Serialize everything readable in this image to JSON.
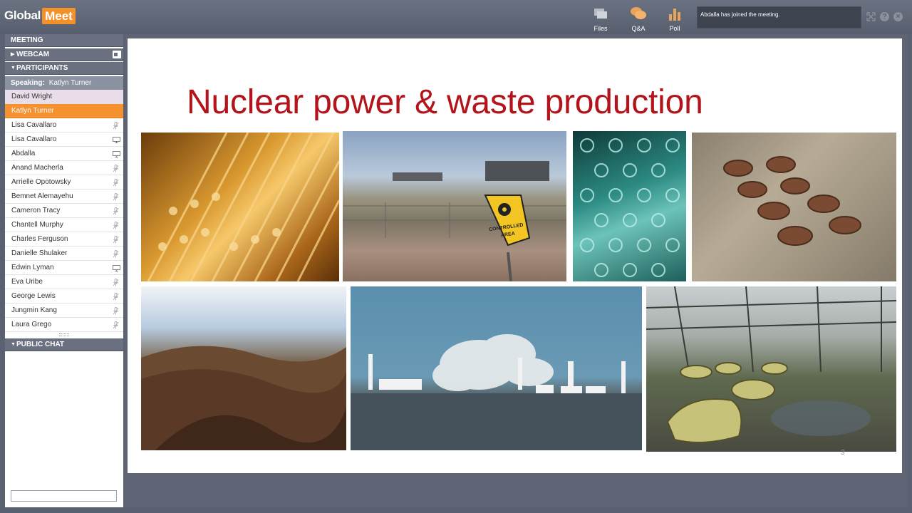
{
  "app": {
    "logo_part1": "Global",
    "logo_part2": "Meet"
  },
  "toolbar": {
    "files_label": "Files",
    "qa_label": "Q&A",
    "poll_label": "Poll"
  },
  "notification": "Abdalla has joined the meeting.",
  "sidebar": {
    "meeting_label": "MEETING",
    "webcam_label": "WEBCAM",
    "participants_label": "PARTICIPANTS",
    "public_chat_label": "PUBLIC CHAT",
    "speaking_label": "Speaking:",
    "speaking_name": "Katlyn Turner",
    "participants": [
      {
        "name": "David Wright",
        "status": "host",
        "icon": "none"
      },
      {
        "name": "Katlyn Turner",
        "status": "active",
        "icon": "none"
      },
      {
        "name": "Lisa Cavallaro",
        "status": "normal",
        "icon": "mic-off-icon"
      },
      {
        "name": "Lisa Cavallaro",
        "status": "normal",
        "icon": "monitor-icon"
      },
      {
        "name": "Abdalla",
        "status": "normal",
        "icon": "monitor-icon"
      },
      {
        "name": "Anand Macherla",
        "status": "normal",
        "icon": "mic-off-icon"
      },
      {
        "name": "Arrielle Opotowsky",
        "status": "normal",
        "icon": "mic-off-icon"
      },
      {
        "name": "Bemnet Alemayehu",
        "status": "normal",
        "icon": "mic-off-icon"
      },
      {
        "name": "Cameron Tracy",
        "status": "normal",
        "icon": "mic-off-icon"
      },
      {
        "name": "Chantell Murphy",
        "status": "normal",
        "icon": "mic-off-icon"
      },
      {
        "name": "Charles Ferguson",
        "status": "normal",
        "icon": "mic-off-icon"
      },
      {
        "name": "Danielle Shulaker",
        "status": "normal",
        "icon": "mic-off-icon"
      },
      {
        "name": "Edwin Lyman",
        "status": "normal",
        "icon": "monitor-icon"
      },
      {
        "name": "Eva Uribe",
        "status": "normal",
        "icon": "mic-off-icon"
      },
      {
        "name": "George Lewis",
        "status": "normal",
        "icon": "mic-off-icon"
      },
      {
        "name": "Jungmin Kang",
        "status": "normal",
        "icon": "mic-off-icon"
      },
      {
        "name": "Laura Grego",
        "status": "normal",
        "icon": "mic-off-icon"
      }
    ]
  },
  "slide": {
    "title": "Nuclear power & waste production",
    "sign_line1": "CONTROLLED",
    "sign_line2": "AREA",
    "page_number": "3"
  },
  "colors": {
    "accent_orange": "#f5922f",
    "title_red": "#b3141b",
    "panel_header": "#6a7080"
  }
}
